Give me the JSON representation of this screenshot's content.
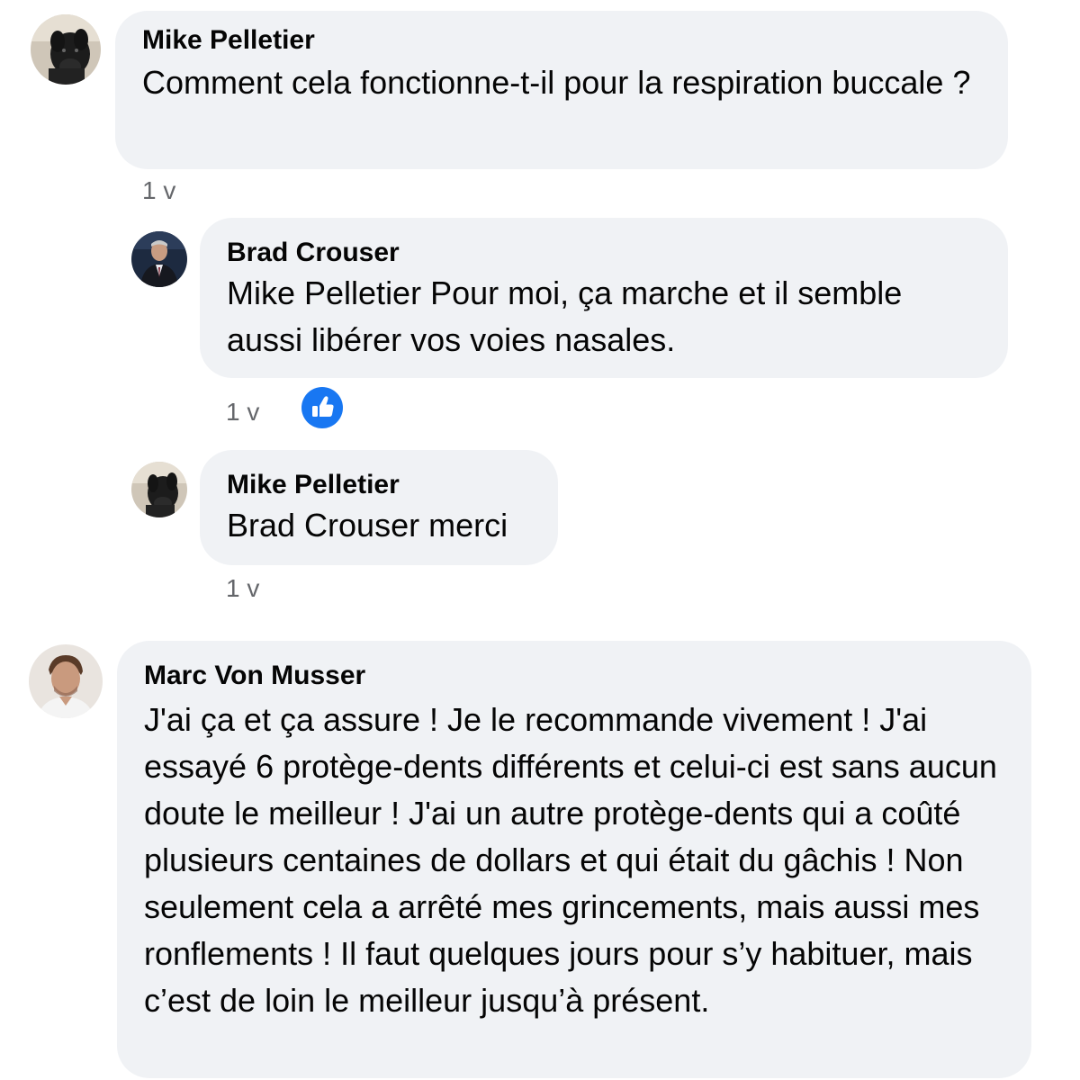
{
  "comments": [
    {
      "author": "Mike Pelletier",
      "text": "Comment cela fonctionne-t-il pour la respiration buccale ?",
      "time": "1 v",
      "avatar_icon": "dog-avatar-icon"
    },
    {
      "author": "Brad Crouser",
      "text": "Mike Pelletier Pour moi, ça marche et il semble aussi libérer vos voies nasales.",
      "time": "1 v",
      "avatar_icon": "man-in-suit-avatar-icon",
      "reaction_icon": "like-thumbs-up-icon"
    },
    {
      "author": "Mike Pelletier",
      "text": "Brad Crouser merci",
      "time": "1 v",
      "avatar_icon": "dog-avatar-icon"
    },
    {
      "author": "Marc Von Musser",
      "text": "J'ai ça et ça assure ! Je le recommande vivement ! J'ai essayé 6 protège-dents différents et celui-ci est sans aucun doute le meilleur ! J'ai un autre protège-dents qui a coûté plusieurs centaines de dollars et qui était du gâchis ! Non seulement cela a arrêté mes grincements, mais aussi mes ronflements ! Il faut quelques jours pour s’y habituer, mais c’est de loin le meilleur jusqu’à présent.",
      "time": "",
      "avatar_icon": "man-portrait-avatar-icon"
    }
  ],
  "colors": {
    "bubble": "#f0f2f5",
    "text": "#050505",
    "meta": "#65676b",
    "like": "#1877f2"
  }
}
